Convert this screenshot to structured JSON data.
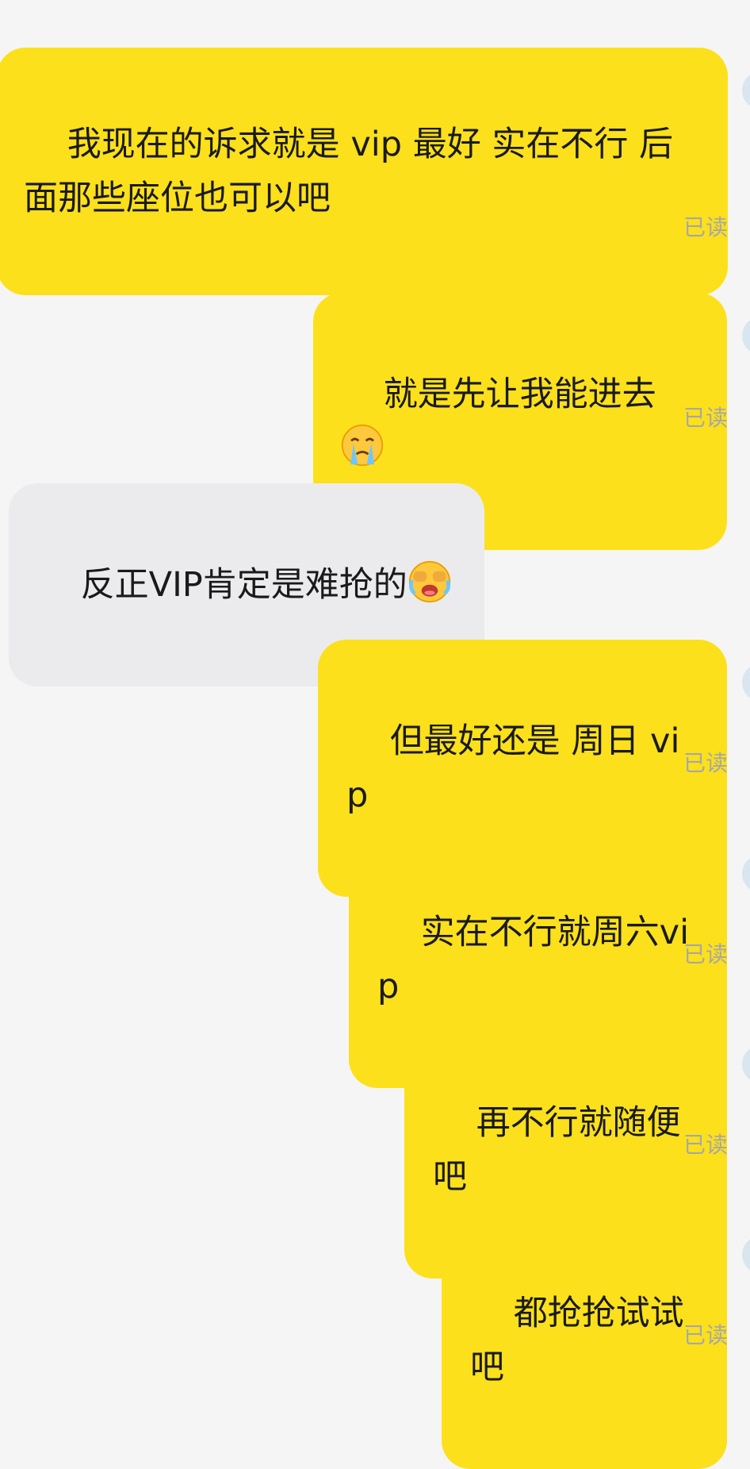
{
  "colors": {
    "background": "#f5f5f5",
    "outgoing_bubble": "#fce01c",
    "incoming_bubble": "#ebebed",
    "read_status": "#a7a7a7"
  },
  "messages": [
    {
      "side": "out",
      "text": "我现在的诉求就是 vip 最好 实在不行 后面那些座位也可以吧",
      "status": "已读"
    },
    {
      "side": "out",
      "text": "就是先让我能进去",
      "emoji": "crying-face-icon",
      "status": "已读"
    },
    {
      "side": "in",
      "text": "反正VIP肯定是难抢的",
      "emoji": "loudly-crying-face-icon"
    },
    {
      "side": "out",
      "text": "但最好还是 周日 vip",
      "status": "已读"
    },
    {
      "side": "out",
      "text": "实在不行就周六vip",
      "status": "已读"
    },
    {
      "side": "out",
      "text": "再不行就随便吧",
      "status": "已读"
    },
    {
      "side": "out",
      "text": "都抢抢试试吧",
      "status": "已读"
    }
  ]
}
